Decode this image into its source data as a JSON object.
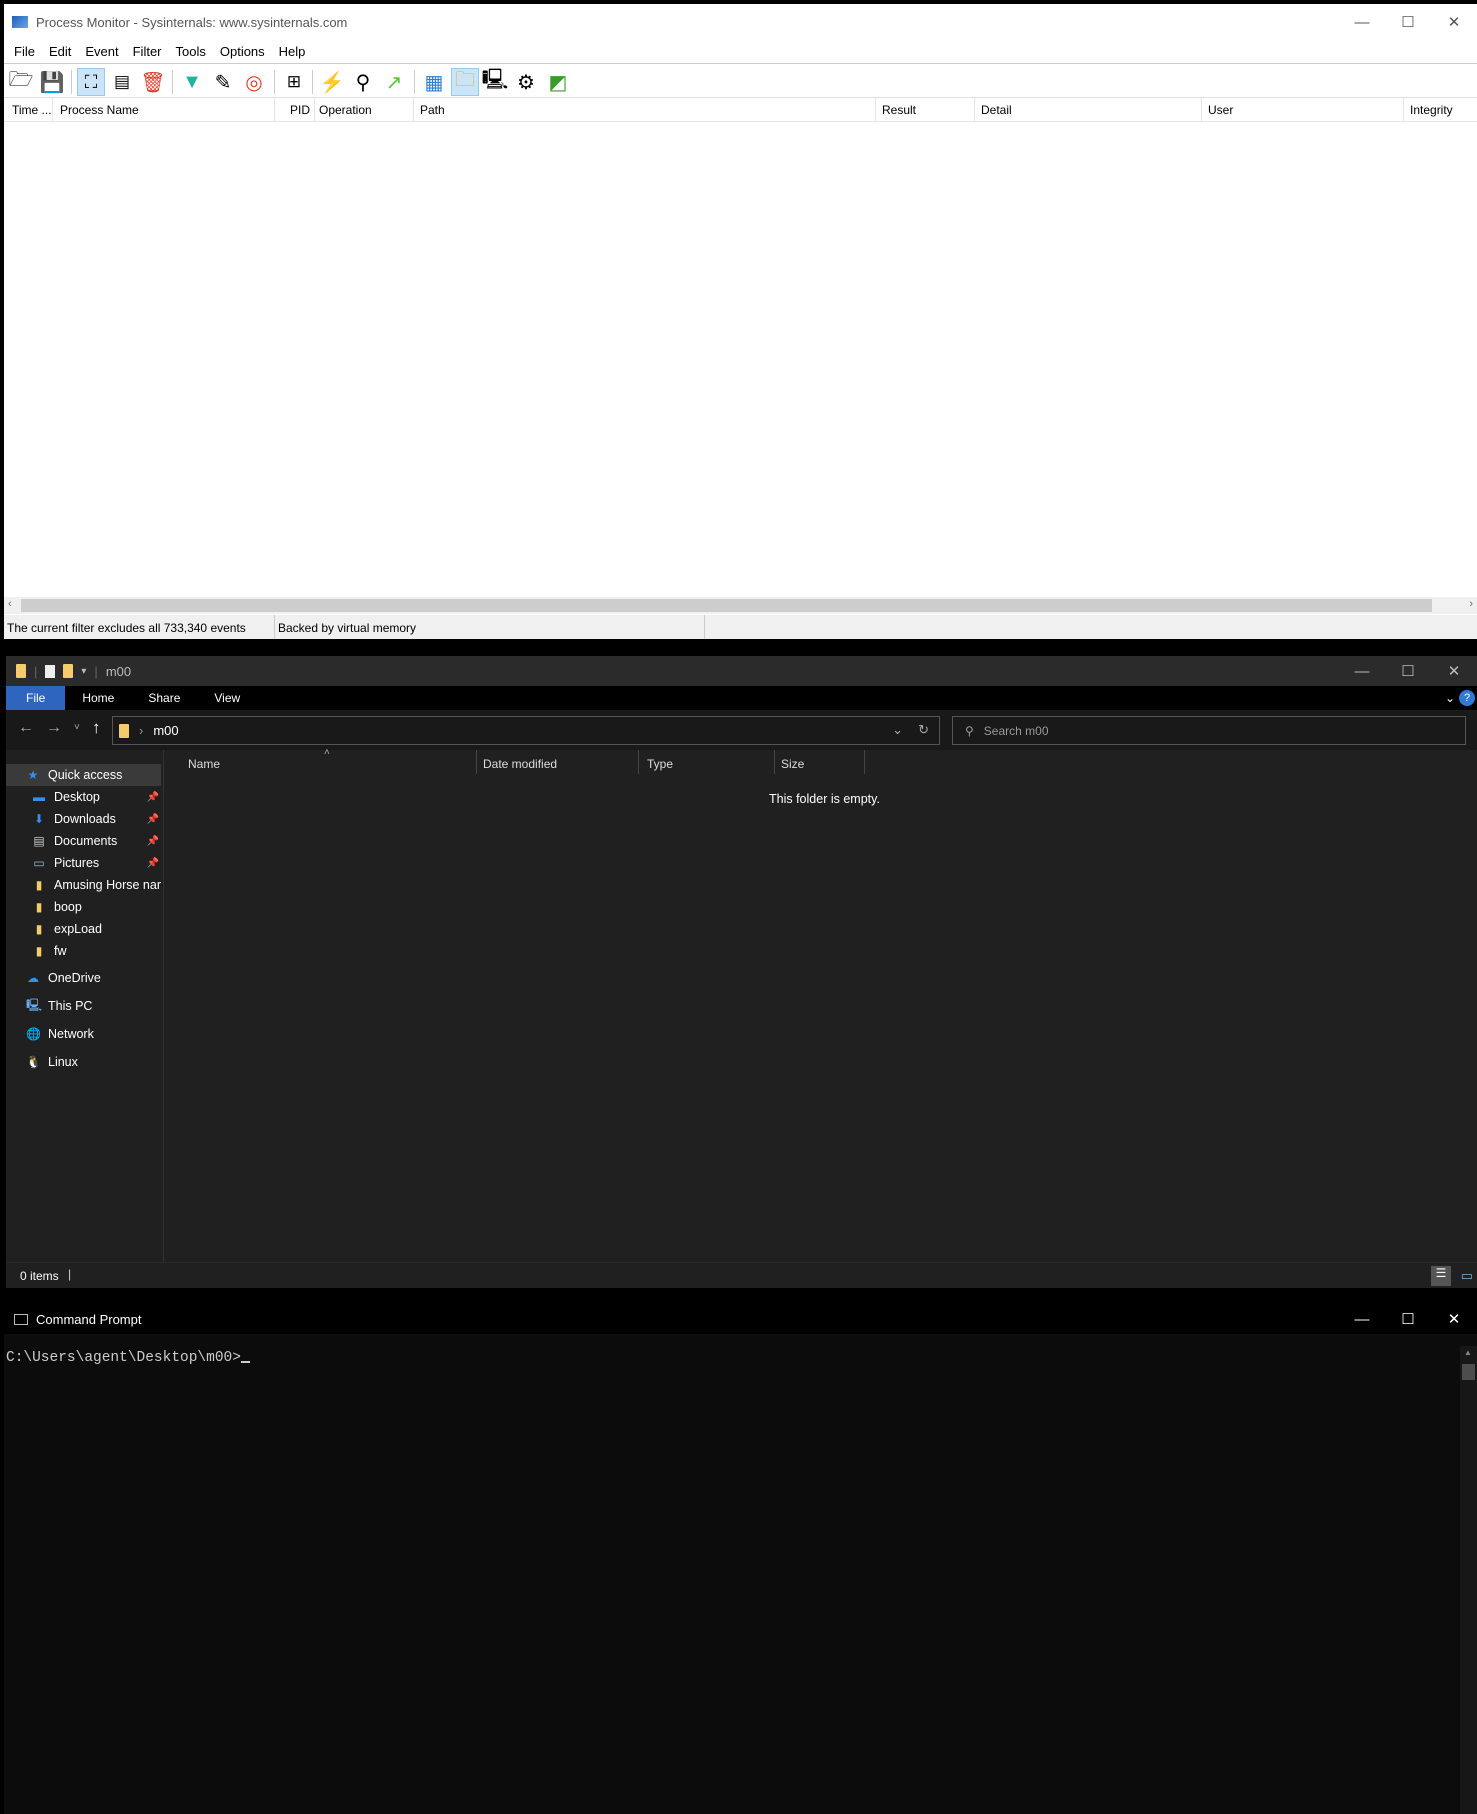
{
  "procmon": {
    "title": "Process Monitor - Sysinternals: www.sysinternals.com",
    "menu": [
      "File",
      "Edit",
      "Event",
      "Filter",
      "Tools",
      "Options",
      "Help"
    ],
    "toolbar": [
      "open-icon",
      "save-icon",
      "capture-icon",
      "autoscroll-icon",
      "clear-icon",
      "filter-icon",
      "highlight-icon",
      "target-icon",
      "process-tree-icon",
      "events-icon",
      "find-icon",
      "jump-icon",
      "registry-activity-icon",
      "file-activity-icon",
      "network-activity-icon",
      "process-activity-icon",
      "profiling-activity-icon"
    ],
    "columns": [
      "Time ...",
      "Process Name",
      "PID",
      "Operation",
      "Path",
      "Result",
      "Detail",
      "User",
      "Integrity"
    ],
    "status": {
      "filter": "The current filter excludes all 733,340 events",
      "memory": "Backed by virtual memory"
    }
  },
  "explorer": {
    "title": "m00",
    "ribbon": [
      "File",
      "Home",
      "Share",
      "View"
    ],
    "address": "m00",
    "search_placeholder": "Search m00",
    "sidebar": [
      {
        "label": "Quick access",
        "icon": "star"
      },
      {
        "label": "Desktop",
        "icon": "desktop",
        "pinned": true
      },
      {
        "label": "Downloads",
        "icon": "download",
        "pinned": true
      },
      {
        "label": "Documents",
        "icon": "document",
        "pinned": true
      },
      {
        "label": "Pictures",
        "icon": "picture",
        "pinned": true
      },
      {
        "label": "Amusing Horse nar",
        "icon": "folder"
      },
      {
        "label": "boop",
        "icon": "folder"
      },
      {
        "label": "expLoad",
        "icon": "folder"
      },
      {
        "label": "fw",
        "icon": "folder"
      },
      {
        "label": "OneDrive",
        "icon": "cloud"
      },
      {
        "label": "This PC",
        "icon": "computer"
      },
      {
        "label": "Network",
        "icon": "network"
      },
      {
        "label": "Linux",
        "icon": "linux"
      }
    ],
    "columns": [
      "Name",
      "Date modified",
      "Type",
      "Size"
    ],
    "empty_text": "This folder is empty.",
    "status": "0 items"
  },
  "cmd": {
    "title": "Command Prompt",
    "prompt": "C:\\Users\\agent\\Desktop\\m00>"
  }
}
